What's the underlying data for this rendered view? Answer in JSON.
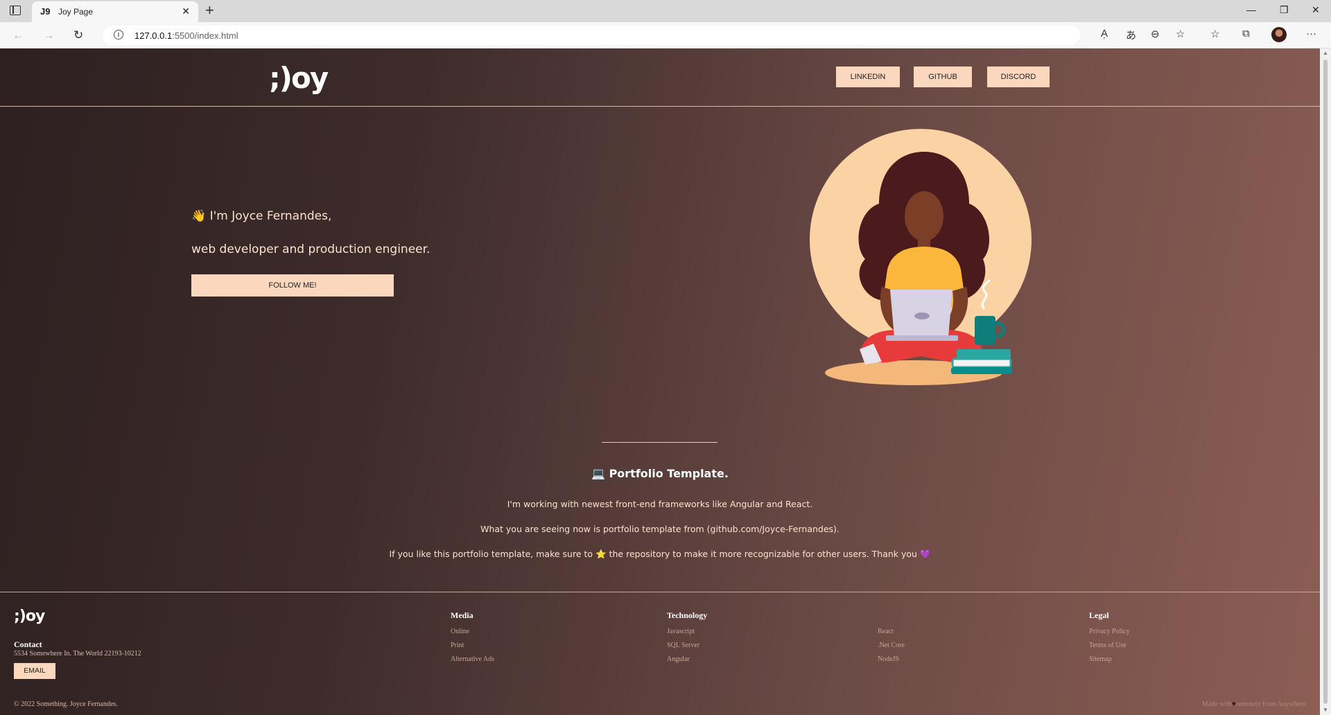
{
  "browser": {
    "tab_title": "Joy Page",
    "tab_favicon": "J9",
    "url_host": "127.0.0.1",
    "url_path": ":5500/index.html",
    "icons": [
      "back-icon",
      "forward-icon",
      "refresh-icon",
      "info-icon",
      "read-aloud-icon",
      "translate-icon",
      "zoom-out-icon",
      "add-favorite-icon",
      "favorites-icon",
      "collections-icon",
      "more-icon"
    ]
  },
  "header": {
    "logo": ";)oy",
    "nav": [
      "LINKEDIN",
      "GITHUB",
      "DISCORD"
    ]
  },
  "hero": {
    "greeting_emoji": "👋",
    "greeting": "I'm Joyce Fernandes,",
    "tagline": "web developer and production engineer.",
    "cta": "FOLLOW ME!"
  },
  "portfolio": {
    "emoji": "💻",
    "title": "Portfolio Template.",
    "line1": "I'm working with newest front-end frameworks like Angular and React.",
    "line2": "What you are seeing now is portfolio template from (github.com/Joyce-Fernandes).",
    "line3_before": "If you like this portfolio template, make sure to",
    "line3_star": "⭐",
    "line3_after": "the repository to make it more recognizable for other users. Thank you",
    "line3_heart": "💜"
  },
  "footer": {
    "logo": ";)oy",
    "contact_title": "Contact",
    "address": "5534 Somewhere In. The World 22193-10212",
    "email_button": "EMAIL",
    "media": {
      "title": "Media",
      "links": [
        "Online",
        "Print",
        "Alternative Ads"
      ]
    },
    "technology": {
      "title": "Technology",
      "links": [
        "Javascript",
        "SQL Server",
        "Angular"
      ]
    },
    "technology2": {
      "links": [
        "React",
        ".Net Core",
        "NodeJS"
      ]
    },
    "legal": {
      "title": "Legal",
      "links": [
        "Privacy Policy",
        "Terms of Use",
        "Sitemap"
      ]
    },
    "copyright": "© 2022 Something. Joyce Fernandes.",
    "made_before": "Made with",
    "made_heart": "♥",
    "made_after": "remotely from Anywhere"
  },
  "colors": {
    "accent_button": "#fad7bd",
    "text_light": "#fbe3d0",
    "bg_dark": "#2d2020",
    "bg_warm": "#8c5e54"
  }
}
